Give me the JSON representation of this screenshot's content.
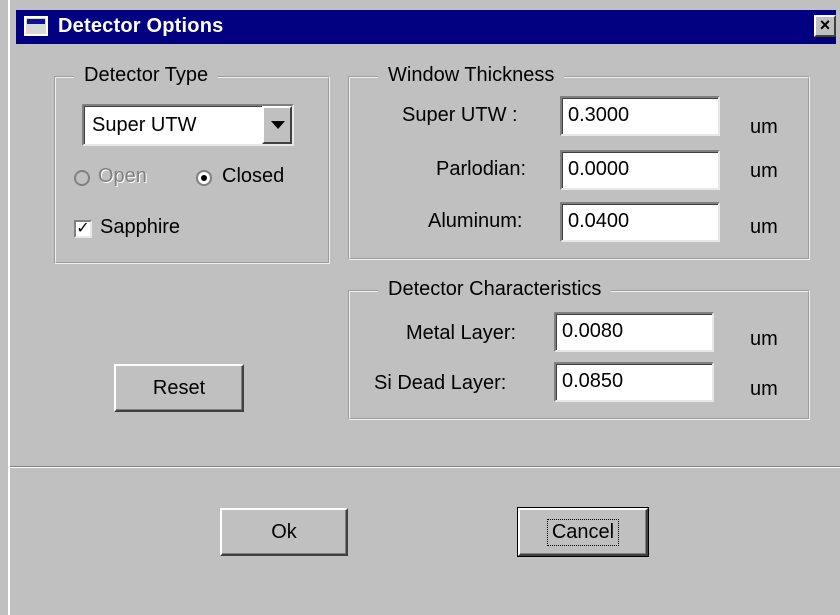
{
  "window": {
    "title": "Detector Options",
    "close_glyph": "×"
  },
  "detector_type": {
    "legend": "Detector Type",
    "selected": "Super UTW",
    "radio_open": "Open",
    "radio_closed": "Closed",
    "radio_selected": "Closed",
    "sapphire_label": "Sapphire",
    "sapphire_checked": true
  },
  "window_thickness": {
    "legend": "Window Thickness",
    "rows": [
      {
        "label": "Super UTW :",
        "value": "0.3000",
        "unit": "um"
      },
      {
        "label": "Parlodian:",
        "value": "0.0000",
        "unit": "um"
      },
      {
        "label": "Aluminum:",
        "value": "0.0400",
        "unit": "um"
      }
    ]
  },
  "detector_characteristics": {
    "legend": "Detector Characteristics",
    "rows": [
      {
        "label": "Metal Layer:",
        "value": "0.0080",
        "unit": "um"
      },
      {
        "label": "Si Dead Layer:",
        "value": "0.0850",
        "unit": "um"
      }
    ]
  },
  "buttons": {
    "reset": "Reset",
    "ok": "Ok",
    "cancel": "Cancel"
  },
  "colors": {
    "titlebar": "#000080",
    "face": "#c0c0c0"
  }
}
